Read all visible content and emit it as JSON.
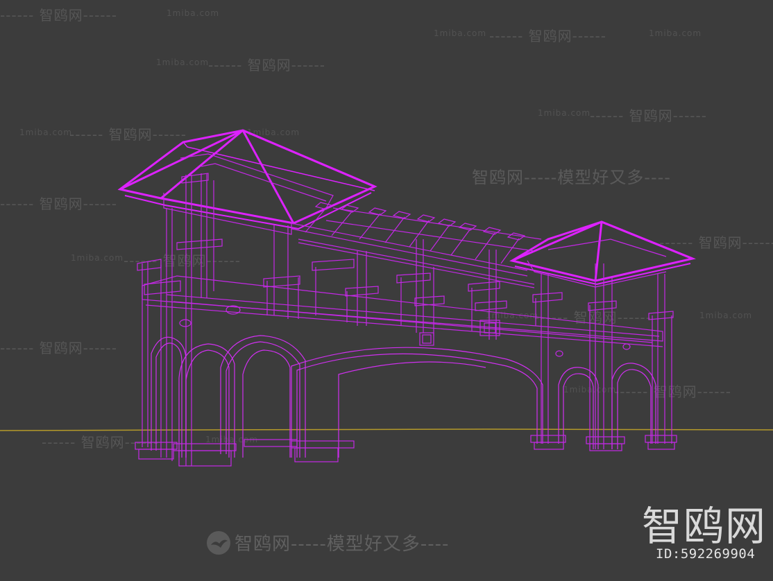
{
  "viewport": {
    "background": "#3c3c3c",
    "wire_color": "#cc22ee",
    "wire_color_bright": "#e020ff",
    "ground_line_color": "#b59a2a"
  },
  "watermarks": {
    "site": "1miba.com",
    "brand_short": "智鸥网",
    "slogan": "智鸥网-----模型好又多----",
    "dash_brand": "------ 智鸥网------",
    "dash_brand_alt": "------ 智鸥网------"
  },
  "brand": {
    "logo_text": "智鸥网",
    "id_label": "ID:592269904"
  },
  "bottom_logo": {
    "icon": "seagull-icon",
    "text": "智鸥网-----模型好又多----"
  }
}
